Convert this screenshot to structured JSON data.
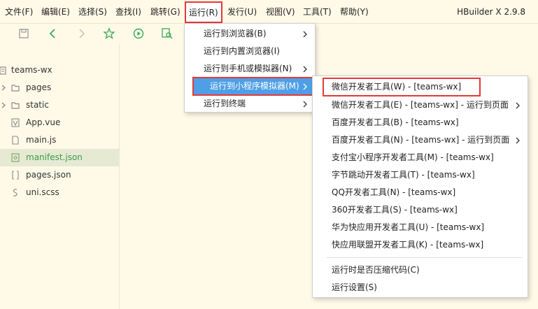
{
  "menubar": {
    "items": [
      {
        "label": "文件(F)"
      },
      {
        "label": "编辑(E)"
      },
      {
        "label": "选择(S)"
      },
      {
        "label": "查找(I)"
      },
      {
        "label": "跳转(G)"
      },
      {
        "label": "运行(R)"
      },
      {
        "label": "发行(U)"
      },
      {
        "label": "视图(V)"
      },
      {
        "label": "工具(T)"
      },
      {
        "label": "帮助(Y)"
      }
    ],
    "app_title": "HBuilder X 2.9.8"
  },
  "toolbar": {
    "icons": [
      "save-icon",
      "back-icon",
      "forward-icon",
      "star-icon",
      "run-icon",
      "browser-preview-icon"
    ]
  },
  "explorer": {
    "project": "teams-wx",
    "items": [
      {
        "label": "pages",
        "type": "folder"
      },
      {
        "label": "static",
        "type": "folder"
      },
      {
        "label": "App.vue",
        "type": "vue"
      },
      {
        "label": "main.js",
        "type": "file"
      },
      {
        "label": "manifest.json",
        "type": "config",
        "selected": true
      },
      {
        "label": "pages.json",
        "type": "json"
      },
      {
        "label": "uni.scss",
        "type": "scss"
      }
    ]
  },
  "run_menu": {
    "items": [
      {
        "label": "运行到浏览器(B)",
        "submenu": true
      },
      {
        "label": "运行到内置浏览器(I)",
        "submenu": false
      },
      {
        "label": "运行到手机或模拟器(N)",
        "submenu": true
      },
      {
        "label": "运行到小程序模拟器(M)",
        "submenu": true,
        "highlighted": true
      },
      {
        "label": "运行到终端",
        "submenu": true
      }
    ]
  },
  "miniprogram_menu": {
    "items": [
      {
        "label": "微信开发者工具(W) - [teams-wx]",
        "submenu": false,
        "boxed": true
      },
      {
        "label": "微信开发者工具(E) - [teams-wx] - 运行到页面",
        "submenu": true
      },
      {
        "label": "百度开发者工具(B) - [teams-wx]",
        "submenu": false
      },
      {
        "label": "百度开发者工具(N) - [teams-wx] - 运行到页面",
        "submenu": true
      },
      {
        "label": "支付宝小程序开发者工具(M) - [teams-wx]",
        "submenu": false
      },
      {
        "label": "字节跳动开发者工具(T) - [teams-wx]",
        "submenu": false
      },
      {
        "label": "QQ开发者工具(N) - [teams-wx]",
        "submenu": false
      },
      {
        "label": "360开发者工具(S) - [teams-wx]",
        "submenu": false
      },
      {
        "label": "华为快应用开发者工具(U) - [teams-wx]",
        "submenu": false
      },
      {
        "label": "快应用联盟开发者工具(K) - [teams-wx]",
        "submenu": false
      }
    ],
    "footer_items": [
      {
        "label": "运行时是否压缩代码(C)"
      },
      {
        "label": "运行设置(S)"
      }
    ]
  },
  "colors": {
    "background": "#fffae8",
    "highlight": "#4f9fe6",
    "annotation_red": "#e53935",
    "selected_text": "#3b9b4a",
    "toolbar_green": "#3aa757"
  }
}
